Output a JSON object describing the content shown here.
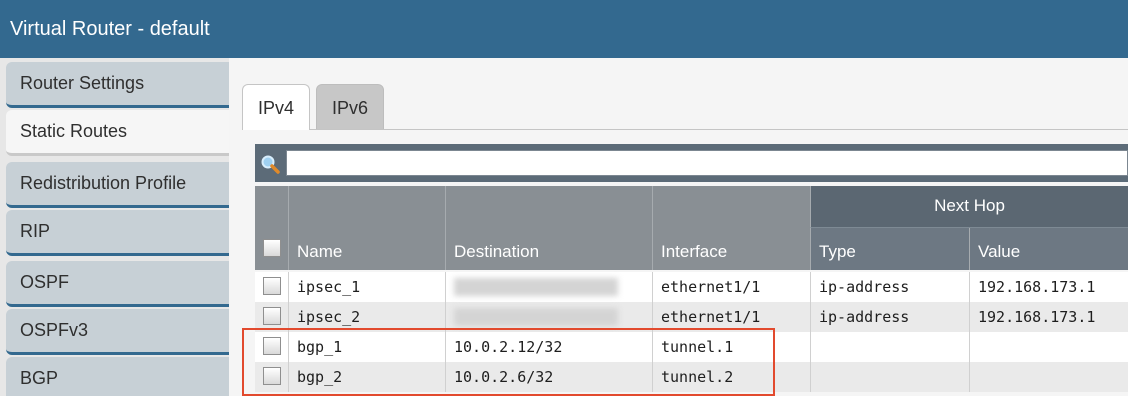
{
  "window": {
    "title": "Virtual Router - default"
  },
  "sidebar": {
    "items": [
      {
        "label": "Router Settings"
      },
      {
        "label": "Static Routes"
      },
      {
        "label": "Redistribution Profile"
      },
      {
        "label": "RIP"
      },
      {
        "label": "OSPF"
      },
      {
        "label": "OSPFv3"
      },
      {
        "label": "BGP"
      }
    ],
    "active_index": 1
  },
  "tabs": [
    {
      "label": "IPv4"
    },
    {
      "label": "IPv6"
    }
  ],
  "search": {
    "value": "",
    "icon": "search-icon"
  },
  "table": {
    "headers": {
      "name": "Name",
      "destination": "Destination",
      "interface": "Interface",
      "next_hop": "Next Hop",
      "type": "Type",
      "value": "Value"
    },
    "rows": [
      {
        "name": "ipsec_1",
        "destination": "",
        "destination_redacted": true,
        "interface": "ethernet1/1",
        "type": "ip-address",
        "value": "192.168.173.1"
      },
      {
        "name": "ipsec_2",
        "destination": "",
        "destination_redacted": true,
        "interface": "ethernet1/1",
        "type": "ip-address",
        "value": "192.168.173.1"
      },
      {
        "name": "bgp_1",
        "destination": "10.0.2.12/32",
        "interface": "tunnel.1",
        "type": "",
        "value": ""
      },
      {
        "name": "bgp_2",
        "destination": "10.0.2.6/32",
        "interface": "tunnel.2",
        "type": "",
        "value": ""
      }
    ]
  },
  "colors": {
    "titlebar": "#33698f",
    "highlight_box": "#e24a2e"
  }
}
